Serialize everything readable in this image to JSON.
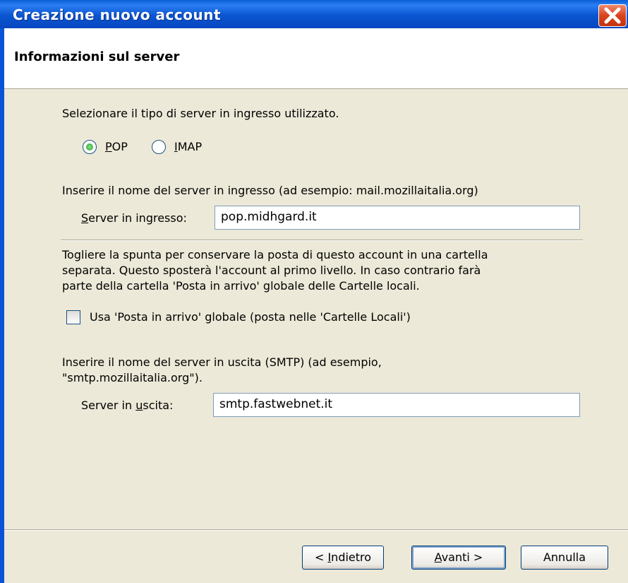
{
  "window": {
    "title": "Creazione nuovo account"
  },
  "header": {
    "title": "Informazioni sul server"
  },
  "incoming_type": {
    "prompt": "Selezionare il tipo di server in ingresso utilizzato.",
    "options": [
      {
        "mnemonic": "P",
        "rest": "OP",
        "selected": true
      },
      {
        "mnemonic": "I",
        "rest": "MAP",
        "selected": false
      }
    ]
  },
  "incoming_server": {
    "description": "Inserire il nome del server in ingresso (ad esempio: mail.mozillaitalia.org)",
    "label_mnemonic": "S",
    "label_rest": "erver in ingresso:",
    "value": "pop.midhgard.it"
  },
  "inbox": {
    "description_lines": [
      "Togliere la spunta per conservare la posta di questo account in una cartella",
      "separata. Questo sposterà l'account al primo livello. In caso contrario farà",
      "parte della cartella 'Posta in arrivo' globale delle Cartelle locali."
    ],
    "checkbox_label": "Usa 'Posta in arrivo' globale (posta nelle 'Cartelle Locali')",
    "checked": false
  },
  "outgoing_server": {
    "description_lines": [
      "Inserire il nome del server in uscita (SMTP) (ad esempio,",
      "\"smtp.mozillaitalia.org\")."
    ],
    "label_pre": "Server in ",
    "label_mnemonic": "u",
    "label_post": "scita:",
    "value": "smtp.fastwebnet.it"
  },
  "buttons": {
    "back": {
      "pre": "< ",
      "mnemonic": "I",
      "post": "ndietro"
    },
    "next": {
      "mnemonic": "A",
      "post": "vanti >"
    },
    "cancel": {
      "label": "Annulla"
    }
  },
  "colors": {
    "titlebar": "#0a55d0",
    "close": "#d9441d",
    "dialog_bg": "#ece9d8"
  },
  "icons": {
    "close": "close-icon"
  }
}
